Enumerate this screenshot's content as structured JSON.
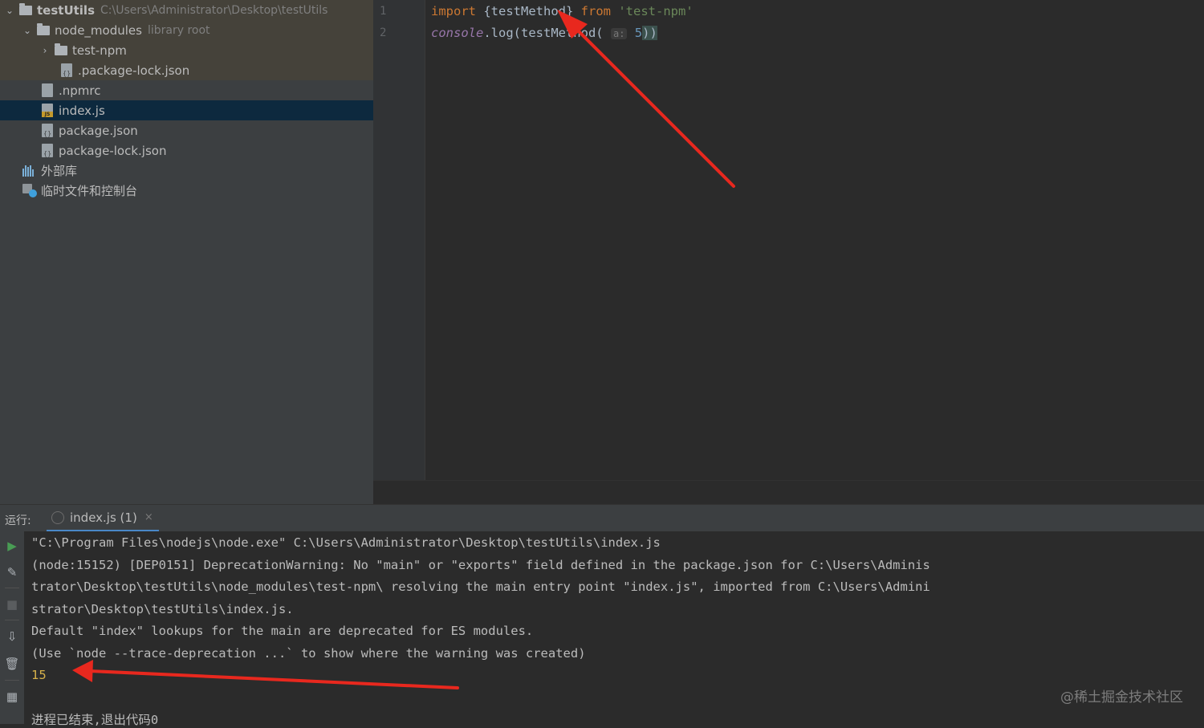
{
  "project_tree": {
    "items": [
      {
        "label": "testUtils",
        "path": "C:\\Users\\Administrator\\Desktop\\testUtils"
      },
      {
        "label": "node_modules",
        "suffix": "library root"
      },
      {
        "label": "test-npm"
      },
      {
        "label": ".package-lock.json"
      },
      {
        "label": ".npmrc"
      },
      {
        "label": "index.js"
      },
      {
        "label": "package.json"
      },
      {
        "label": "package-lock.json"
      },
      {
        "label": "外部库"
      },
      {
        "label": "临时文件和控制台"
      }
    ]
  },
  "editor": {
    "line_numbers": [
      "1",
      "2"
    ],
    "line1": {
      "kw_import": "import",
      "brace_open": " {",
      "name": "testMethod",
      "brace_close": "} ",
      "kw_from": "from",
      "space": " ",
      "module": "'test-npm'"
    },
    "line2": {
      "obj": "console",
      "call": ".log(testMethod(",
      "hint": "a:",
      "arg": "5",
      "close": "))"
    }
  },
  "run_panel": {
    "title": "运行:",
    "tab_label": "index.js (1)",
    "tab_close": "×",
    "console_lines": [
      "\"C:\\Program Files\\nodejs\\node.exe\" C:\\Users\\Administrator\\Desktop\\testUtils\\index.js",
      "(node:15152) [DEP0151] DeprecationWarning: No \"main\" or \"exports\" field defined in the package.json for C:\\Users\\Adminis",
      "trator\\Desktop\\testUtils\\node_modules\\test-npm\\ resolving the main entry point \"index.js\", imported from C:\\Users\\Admini",
      "strator\\Desktop\\testUtils\\index.js.",
      "Default \"index\" lookups for the main are deprecated for ES modules.",
      "(Use `node --trace-deprecation ...` to show where the warning was created)",
      "15",
      "",
      "进程已结束,退出代码0"
    ],
    "watermark": "@稀土掘金技术社区"
  },
  "colors": {
    "keyword": "#cc7832",
    "string": "#6a8759",
    "function": "#ffc66d",
    "number": "#6897bb",
    "selection": "#0d293e",
    "annotation_arrow": "#e8281e"
  }
}
